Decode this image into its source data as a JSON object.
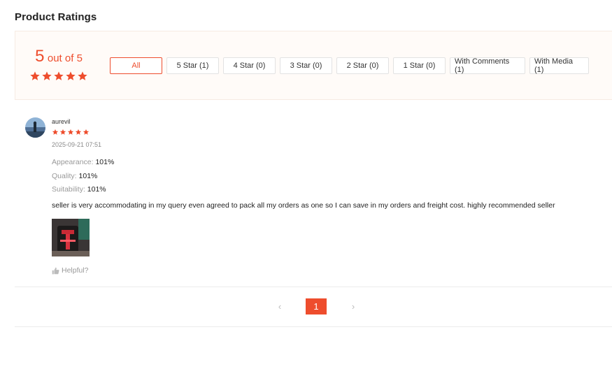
{
  "section": {
    "title": "Product Ratings"
  },
  "summary": {
    "score": "5",
    "out_of": "out of 5",
    "stars": 5,
    "filters": [
      {
        "label": "All",
        "active": true
      },
      {
        "label": "5 Star (1)",
        "active": false
      },
      {
        "label": "4 Star (0)",
        "active": false
      },
      {
        "label": "3 Star (0)",
        "active": false
      },
      {
        "label": "2 Star (0)",
        "active": false
      },
      {
        "label": "1 Star (0)",
        "active": false
      },
      {
        "label": "With Comments (1)",
        "active": false
      },
      {
        "label": "With Media (1)",
        "active": false
      }
    ]
  },
  "review": {
    "username": "aurevil",
    "stars": 5,
    "date": "2025-09-21 07:51",
    "attributes": [
      {
        "key": "Appearance:",
        "value": "101%"
      },
      {
        "key": "Quality:",
        "value": "101%"
      },
      {
        "key": "Suitability:",
        "value": "101%"
      }
    ],
    "comment": "seller is very accommodating in my query even agreed to pack all my orders as one so I can save in my orders and freight cost. highly recommended seller",
    "helpful_label": "Helpful?"
  },
  "pagination": {
    "current": "1",
    "prev_icon": "chevron-left-icon",
    "next_icon": "chevron-right-icon"
  },
  "colors": {
    "accent": "#ee4d2d",
    "summary_bg": "#fffbf8",
    "muted": "#999999"
  }
}
